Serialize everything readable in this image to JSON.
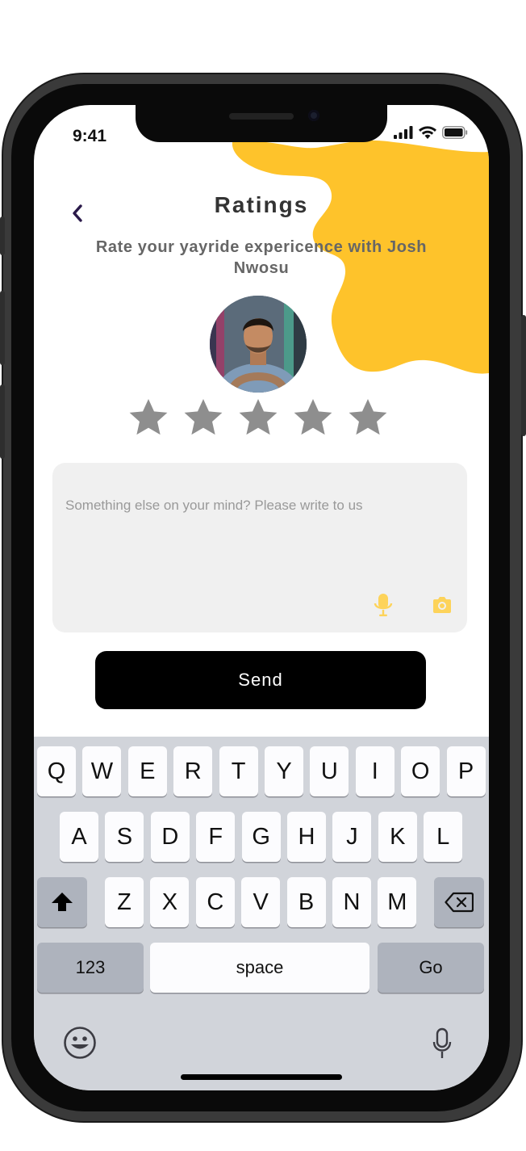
{
  "status_bar": {
    "time": "9:41",
    "icons": [
      "signal-icon",
      "wifi-icon",
      "battery-icon"
    ]
  },
  "header": {
    "back_icon": "chevron-left-icon",
    "title": "Ratings"
  },
  "subtitle": "Rate your yayride expericence with Josh Nwosu",
  "driver": {
    "avatar": "driver-photo"
  },
  "rating": {
    "max_stars": 5,
    "selected": 0,
    "star_color": "#8e8e8e"
  },
  "feedback": {
    "placeholder": "Something else on your mind? Please write to us",
    "icons": [
      "microphone-icon",
      "camera-icon"
    ],
    "icon_color": "#fdd35a"
  },
  "send_button": {
    "label": "Send"
  },
  "keyboard": {
    "row1": [
      "Q",
      "W",
      "E",
      "R",
      "T",
      "Y",
      "U",
      "I",
      "O",
      "P"
    ],
    "row2": [
      "A",
      "S",
      "D",
      "F",
      "G",
      "H",
      "J",
      "K",
      "L"
    ],
    "row3": [
      "Z",
      "X",
      "C",
      "V",
      "B",
      "N",
      "M"
    ],
    "numbers_label": "123",
    "space_label": "space",
    "go_label": "Go",
    "icons": [
      "shift-icon",
      "backspace-icon",
      "emoji-icon",
      "dictation-icon"
    ]
  },
  "colors": {
    "accent": "#fec32b",
    "button": "#000000",
    "text": "#333333"
  }
}
